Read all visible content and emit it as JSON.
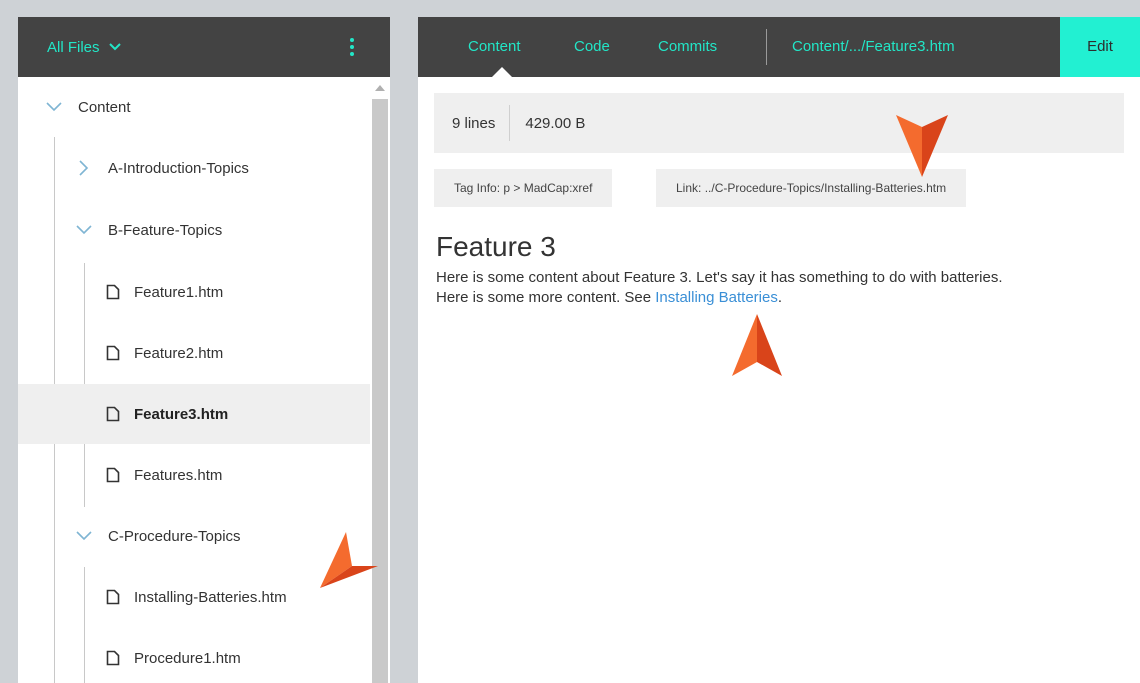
{
  "sidebar": {
    "title": "All Files",
    "tree": [
      {
        "label": "Content",
        "type": "folder",
        "expanded": true,
        "level": 0
      },
      {
        "label": "A-Introduction-Topics",
        "type": "folder",
        "expanded": false,
        "level": 1
      },
      {
        "label": "B-Feature-Topics",
        "type": "folder",
        "expanded": true,
        "level": 1
      },
      {
        "label": "Feature1.htm",
        "type": "file",
        "level": 2
      },
      {
        "label": "Feature2.htm",
        "type": "file",
        "level": 2
      },
      {
        "label": "Feature3.htm",
        "type": "file",
        "level": 2,
        "selected": true
      },
      {
        "label": "Features.htm",
        "type": "file",
        "level": 2
      },
      {
        "label": "C-Procedure-Topics",
        "type": "folder",
        "expanded": true,
        "level": 1
      },
      {
        "label": "Installing-Batteries.htm",
        "type": "file",
        "level": 2
      },
      {
        "label": "Procedure1.htm",
        "type": "file",
        "level": 2
      }
    ]
  },
  "toolbar": {
    "tabs": [
      {
        "label": "Content",
        "active": true
      },
      {
        "label": "Code"
      },
      {
        "label": "Commits"
      }
    ],
    "path": "Content/.../Feature3.htm",
    "edit_label": "Edit"
  },
  "file_info": {
    "lines": "9 lines",
    "size": "429.00 B"
  },
  "tag_info": {
    "prefix": "Tag Info:",
    "value": "p > MadCap:xref"
  },
  "link_info": {
    "prefix": "Link:",
    "value": "../C-Procedure-Topics/Installing-Batteries.htm"
  },
  "document": {
    "title": "Feature 3",
    "line1": "Here is some content about Feature 3. Let's say it has something to do with batteries.",
    "line2_text": "Here is some more content. See ",
    "line2_link": "Installing Batteries",
    "line2_end": "."
  },
  "colors": {
    "accent": "#22e6c7",
    "header_bg": "#434343",
    "edit_bg": "#22f0d2",
    "link": "#3a8fd6",
    "callout": "#f05a24"
  },
  "icons": {
    "menu": "kebab-menu-icon",
    "dropdown": "chevron-down-icon",
    "file": "file-icon",
    "expand": "chevron-right-icon",
    "collapse": "chevron-down-icon"
  }
}
